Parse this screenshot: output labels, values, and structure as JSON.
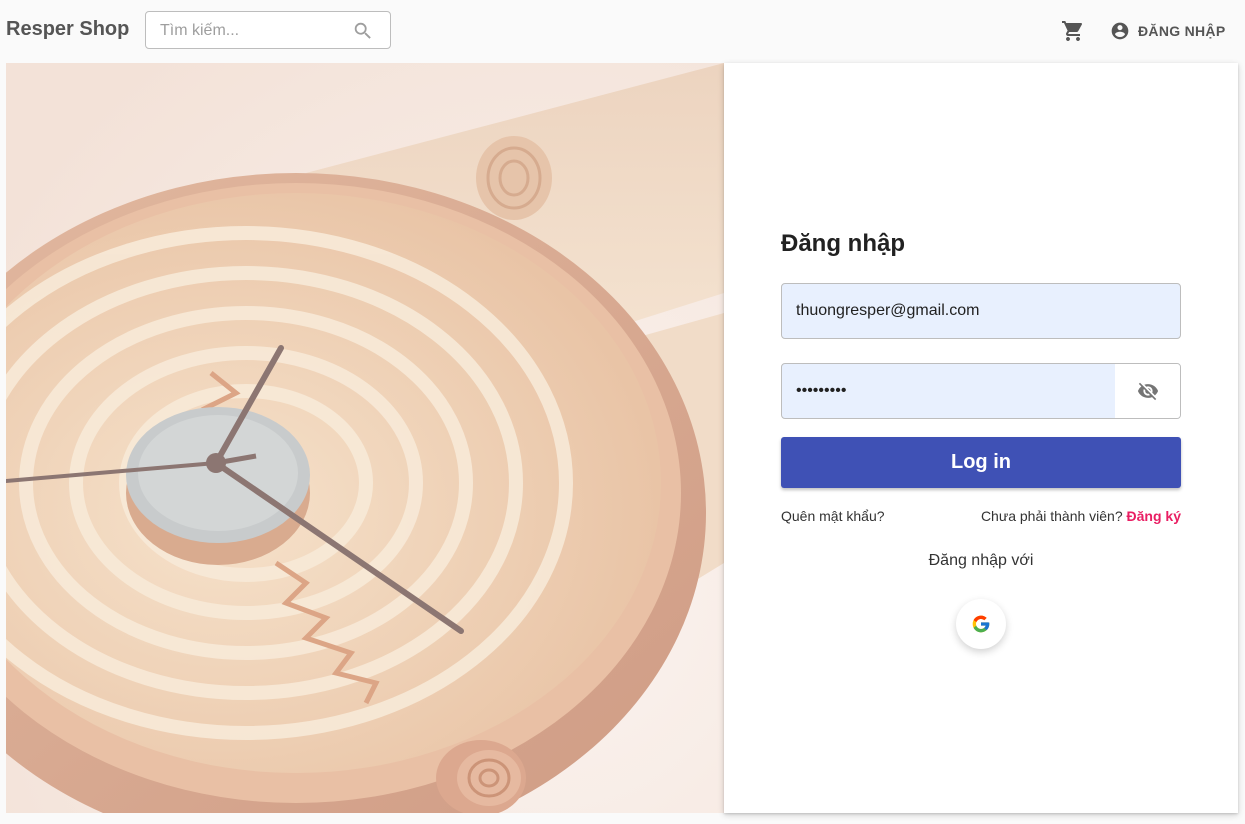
{
  "header": {
    "brand": "Resper Shop",
    "search_placeholder": "Tìm kiếm...",
    "search_icon": "search-icon",
    "cart_icon": "cart-icon",
    "account_icon": "account-circle-icon",
    "login_label": "ĐĂNG NHẬP"
  },
  "hero": {
    "image": "watch-closeup-photo"
  },
  "login_form": {
    "title": "Đăng nhập",
    "email_value": "thuongresper@gmail.com",
    "password_value": "Resper123",
    "password_toggle_icon": "visibility-off-icon",
    "submit_label": "Log in",
    "forgot_password": "Quên mật khẩu?",
    "not_member": "Chưa phải thành viên? ",
    "signup_link": "Đăng ký",
    "login_with": "Đăng nhập với",
    "google_icon": "google-icon"
  },
  "colors": {
    "primary": "#3f51b5",
    "accent": "#e91e63",
    "input_autofill": "#e8f0fe"
  }
}
